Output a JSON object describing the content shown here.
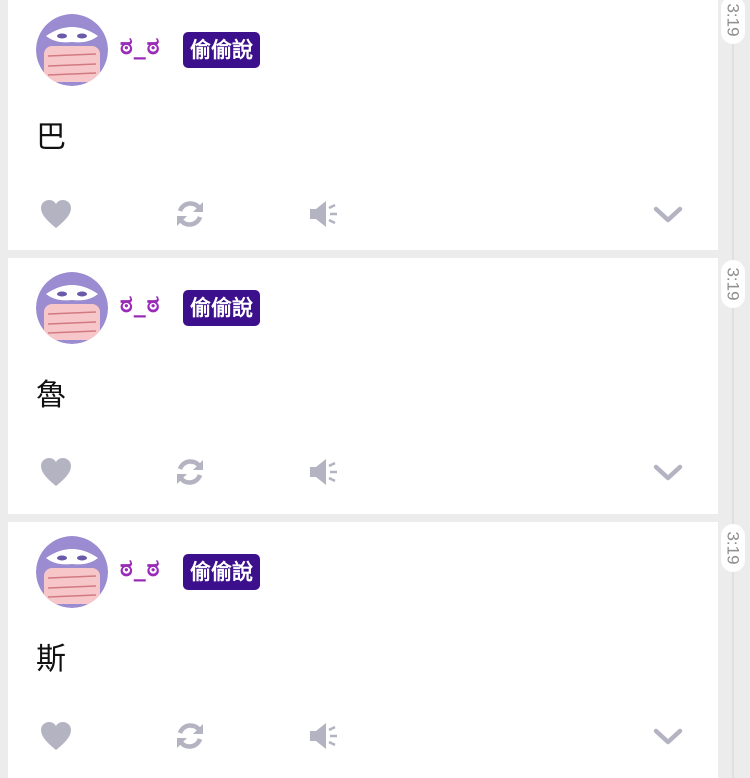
{
  "posts": [
    {
      "username": "ಠ_ಠ",
      "badge": "偷偷說",
      "content": "巴",
      "time": "3:19"
    },
    {
      "username": "ಠ_ಠ",
      "badge": "偷偷說",
      "content": "魯",
      "time": "3:19"
    },
    {
      "username": "ಠ_ಠ",
      "badge": "偷偷說",
      "content": "斯",
      "time": "3:19"
    }
  ],
  "colors": {
    "username": "#9a2bb8",
    "badge_bg": "#3c0f8c",
    "action_icon": "#b3b3c2",
    "avatar_bg": "#9b8bd0"
  },
  "icons": {
    "like": "heart-icon",
    "repost": "refresh-icon",
    "sound": "speaker-icon",
    "more": "chevron-down-icon"
  }
}
